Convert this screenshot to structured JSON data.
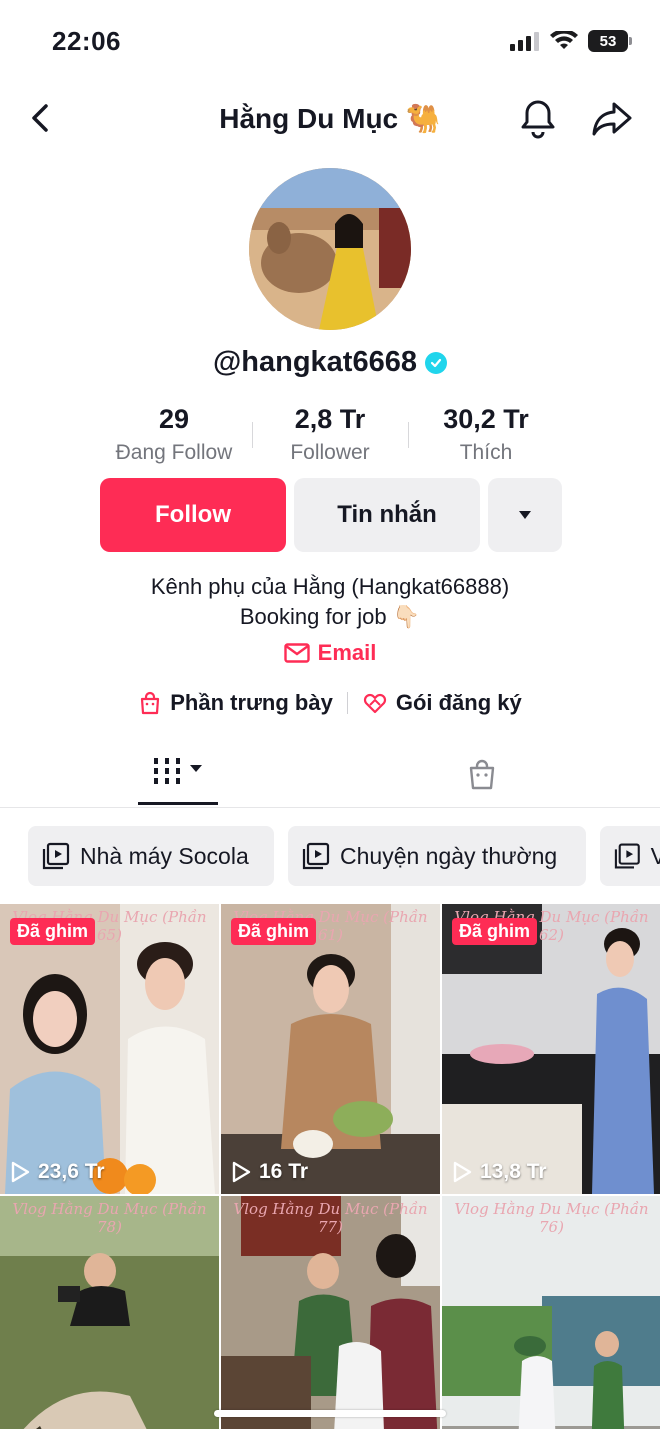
{
  "status_bar": {
    "time": "22:06",
    "battery": "53"
  },
  "header": {
    "title": "Hằng Du Mục 🐫"
  },
  "profile": {
    "username": "@hangkat6668",
    "stats": [
      {
        "value": "29",
        "label": "Đang Follow"
      },
      {
        "value": "2,8 Tr",
        "label": "Follower"
      },
      {
        "value": "30,2 Tr",
        "label": "Thích"
      }
    ],
    "follow_label": "Follow",
    "message_label": "Tin nhắn",
    "bio_line1": "Kênh phụ của Hằng (Hangkat66888)",
    "bio_line2": "Booking for job 👇🏻",
    "email_label": "Email",
    "showcase_label": "Phần trưng bày",
    "subscription_label": "Gói đăng ký"
  },
  "playlists": [
    "Nhà máy Socola",
    "Chuyện ngày thường",
    "V"
  ],
  "videos": [
    {
      "caption": "Vlog Hằng Du Mục (Phần 65)",
      "pinned": "Đã ghim",
      "views": "23,6 Tr",
      "bg": "#d9c7b8"
    },
    {
      "caption": "Vlog Hằng Du Mục (Phần 61)",
      "pinned": "Đã ghim",
      "views": "16 Tr",
      "bg": "#b9a08a"
    },
    {
      "caption": "Vlog Hằng Du Mục (Phần 62)",
      "pinned": "Đã ghim",
      "views": "13,8 Tr",
      "bg": "#8d8f99"
    },
    {
      "caption": "Vlog Hằng Du Mục (Phần 78)",
      "pinned": "",
      "views": "",
      "bg": "#6f7f4c"
    },
    {
      "caption": "Vlog Hằng Du Mục (Phần 77)",
      "pinned": "",
      "views": "",
      "bg": "#7a6a5c"
    },
    {
      "caption": "Vlog Hằng Du Mục (Phần 76)",
      "pinned": "",
      "views": "",
      "bg": "#9fb4a6"
    }
  ],
  "colors": {
    "accent": "#fe2c55",
    "verified": "#20d5ec",
    "text": "#161823",
    "muted": "#73757c"
  }
}
